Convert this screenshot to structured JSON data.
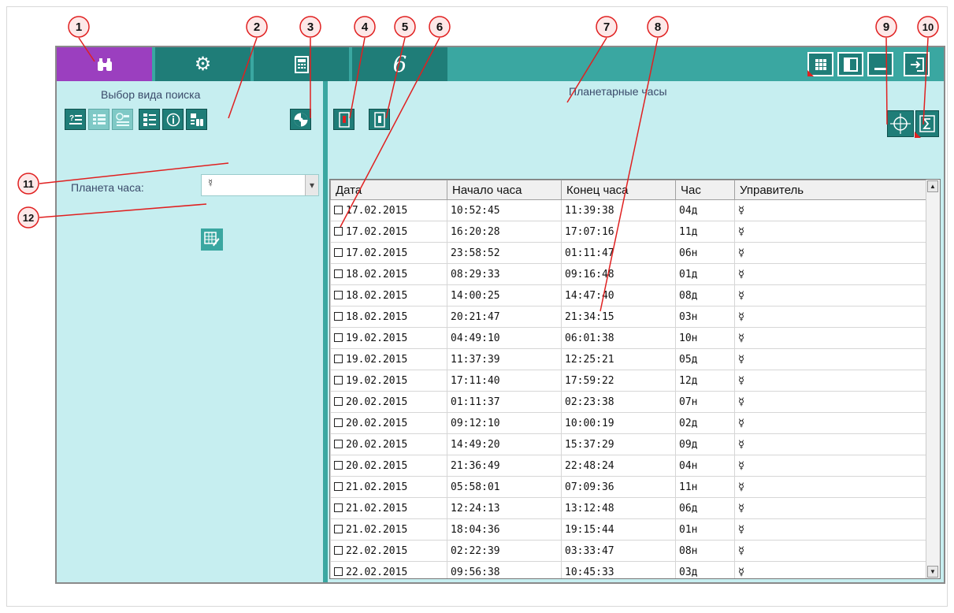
{
  "tabs": {
    "search_icon": "binoculars-icon",
    "settings_icon": "gear-icon",
    "calc_icon": "calculator-icon",
    "logo_text": "6"
  },
  "window_buttons": [
    "grid-view-icon",
    "panel-toggle-icon",
    "minimize-icon",
    "exit-icon"
  ],
  "left_panel": {
    "caption": "Выбор вида поиска",
    "planet_label": "Планета часа:",
    "planet_value": "☿",
    "dropdown_arrow": "▾"
  },
  "right_panel": {
    "caption": "Планетарные часы"
  },
  "table": {
    "columns": [
      "Дата",
      "Начало часа",
      "Конец часа",
      "Час",
      "Управитель"
    ],
    "rows": [
      [
        "17.02.2015",
        "10:52:45",
        "11:39:38",
        "04д",
        "☿"
      ],
      [
        "17.02.2015",
        "16:20:28",
        "17:07:16",
        "11д",
        "☿"
      ],
      [
        "17.02.2015",
        "23:58:52",
        "01:11:47",
        "06н",
        "☿"
      ],
      [
        "18.02.2015",
        "08:29:33",
        "09:16:48",
        "01д",
        "☿"
      ],
      [
        "18.02.2015",
        "14:00:25",
        "14:47:40",
        "08д",
        "☿"
      ],
      [
        "18.02.2015",
        "20:21:47",
        "21:34:15",
        "03н",
        "☿"
      ],
      [
        "19.02.2015",
        "04:49:10",
        "06:01:38",
        "10н",
        "☿"
      ],
      [
        "19.02.2015",
        "11:37:39",
        "12:25:21",
        "05д",
        "☿"
      ],
      [
        "19.02.2015",
        "17:11:40",
        "17:59:22",
        "12д",
        "☿"
      ],
      [
        "20.02.2015",
        "01:11:37",
        "02:23:38",
        "07н",
        "☿"
      ],
      [
        "20.02.2015",
        "09:12:10",
        "10:00:19",
        "02д",
        "☿"
      ],
      [
        "20.02.2015",
        "14:49:20",
        "15:37:29",
        "09д",
        "☿"
      ],
      [
        "20.02.2015",
        "21:36:49",
        "22:48:24",
        "04н",
        "☿"
      ],
      [
        "21.02.2015",
        "05:58:01",
        "07:09:36",
        "11н",
        "☿"
      ],
      [
        "21.02.2015",
        "12:24:13",
        "13:12:48",
        "06д",
        "☿"
      ],
      [
        "21.02.2015",
        "18:04:36",
        "19:15:44",
        "01н",
        "☿"
      ],
      [
        "22.02.2015",
        "02:22:39",
        "03:33:47",
        "08н",
        "☿"
      ],
      [
        "22.02.2015",
        "09:56:38",
        "10:45:33",
        "03д",
        "☿"
      ]
    ]
  },
  "callouts": [
    "1",
    "2",
    "3",
    "4",
    "5",
    "6",
    "7",
    "8",
    "9",
    "10",
    "11",
    "12"
  ],
  "colors": {
    "teal_bar": "#3aa7a1",
    "teal_dark": "#1f7d78",
    "purple_active": "#9b3fbf",
    "panel_bg": "#c6eef0",
    "callout_red": "#e02020"
  }
}
